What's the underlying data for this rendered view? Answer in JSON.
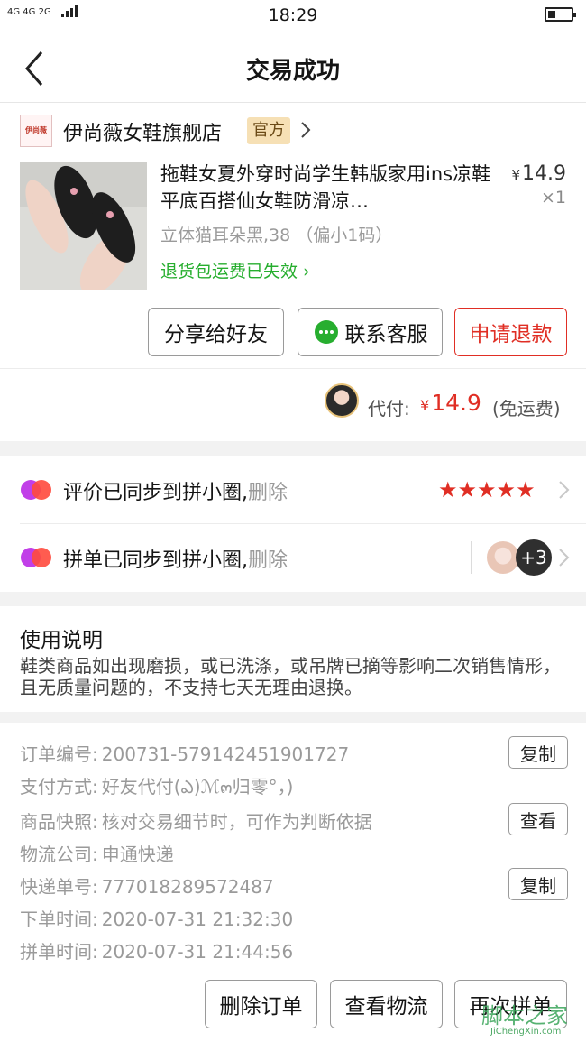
{
  "status_bar": {
    "network": "4G 4G  2G",
    "time": "18:29",
    "battery_level": 0.3
  },
  "nav": {
    "title": "交易成功"
  },
  "store": {
    "logo_text": "伊尚薇",
    "name": "伊尚薇女鞋旗舰店",
    "badge": "官方"
  },
  "product": {
    "title": "拖鞋女夏外穿时尚学生韩版家用ins凉鞋平底百搭仙女鞋防滑凉…",
    "spec": "立体猫耳朵黑,38 （偏小1码）",
    "return_note": "退货包运费已失效",
    "currency": "¥",
    "price": "14.9",
    "qty": "×1"
  },
  "actions": {
    "share": "分享给好友",
    "contact": "联系客服",
    "refund": "申请退款"
  },
  "payment": {
    "label": "代付:",
    "currency": "¥",
    "amount": "14.9",
    "note": "(免运费)"
  },
  "circle": {
    "review": {
      "text": "评价已同步到拼小圈,",
      "delete": "删除",
      "stars": "★★★★★",
      "rating": 5
    },
    "group": {
      "text": "拼单已同步到拼小圈,",
      "delete": "删除",
      "extra": "+3"
    }
  },
  "instructions": {
    "title": "使用说明",
    "body": "鞋类商品如出现磨损，或已洗涤，或吊牌已摘等影响二次销售情形，且无质量问题的，不支持七天无理由退换。"
  },
  "order_info": [
    {
      "label": "订单编号:",
      "value": "200731-579142451901727",
      "button": "复制"
    },
    {
      "label": "支付方式:",
      "value": "好友代付(ఎ)ℳ๓归零°，)"
    },
    {
      "label": "商品快照:",
      "value": "核对交易细节时，可作为判断依据",
      "button": "查看"
    },
    {
      "label": "物流公司:",
      "value": "申通快递"
    },
    {
      "label": "快递单号:",
      "value": "777018289572487",
      "button": "复制"
    },
    {
      "label": "下单时间:",
      "value": "2020-07-31 21:32:30"
    },
    {
      "label": "拼单时间:",
      "value": "2020-07-31 21:44:56"
    }
  ],
  "bottom": {
    "delete_order": "删除订单",
    "track": "查看物流",
    "reorder": "再次拼单"
  },
  "watermark": {
    "text": "脚本之家",
    "sub": "JiChengXin.com"
  },
  "colors": {
    "accent": "#e02e24",
    "green": "#27ae2f",
    "badge_bg": "#f6e0b5"
  }
}
